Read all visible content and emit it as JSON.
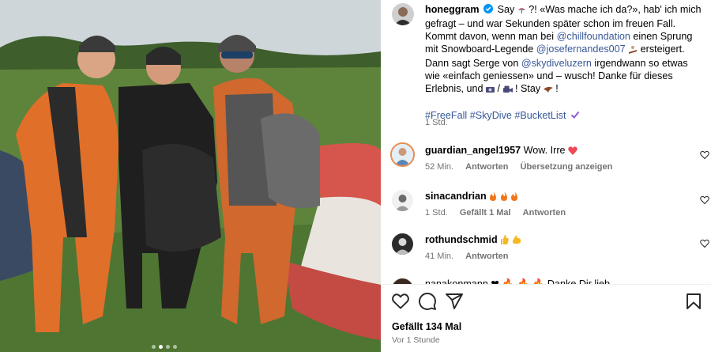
{
  "post": {
    "author": "honeggram",
    "caption_intro": "Say",
    "caption_1": "?! «Was mache ich da?», hab' ich mich gefragt – und war Sekunden später schon im freuen Fall. Kommt davon, wenn man bei",
    "mention_1": "@chillfoundation",
    "caption_2": "einen Sprung mit Snowboard-Legende",
    "mention_2": "@josefernandes007",
    "caption_3": "ersteigert. Dann sagt Serge von",
    "mention_3": "@skydiveluzern",
    "caption_4": "irgendwann so etwas wie «einfach geniessen» und – wusch! Danke für dieses Erlebnis, und",
    "caption_5": "! Stay",
    "caption_6": "!",
    "hashtags": "#FreeFall #SkyDive #BucketList",
    "caption_time": "1 Std.",
    "likes": "Gefällt 134 Mal",
    "posted": "Vor 1 Stunde"
  },
  "comments": [
    {
      "user": "guardian_angel1957",
      "text": "Wow. Irre",
      "time": "52 Min.",
      "likes": "",
      "reply": "Antworten",
      "translate": "Übersetzung anzeigen"
    },
    {
      "user": "sinacandrian",
      "text": "",
      "time": "1 Std.",
      "likes": "Gefällt 1 Mal",
      "reply": "Antworten",
      "translate": ""
    },
    {
      "user": "rothundschmid",
      "text": "",
      "time": "41 Min.",
      "likes": "",
      "reply": "Antworten",
      "translate": ""
    }
  ],
  "partial_comment": "nanakonmann ❤ 🔥 🔥 🔥 Danke Dir lieb",
  "icons": {
    "verified": "verified-badge-icon",
    "like": "heart-icon",
    "comment": "comment-bubble-icon",
    "share": "paper-plane-icon",
    "save": "bookmark-icon"
  },
  "colors": {
    "link": "#385898",
    "verified": "#0095f6",
    "heart": "#ed4956",
    "muted": "#737373"
  },
  "carousel": {
    "slides": 4,
    "active": 1
  }
}
